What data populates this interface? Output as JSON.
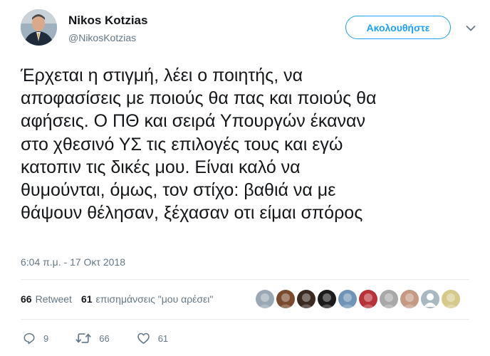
{
  "user": {
    "name": "Nikos Kotzias",
    "handle": "@NikosKotzias",
    "follow_label": "Ακολουθήστε"
  },
  "tweet": {
    "text": "Έρχεται η στιγμή, λέει ο ποιητής, να\nαποφασίσεις με ποιούς θα πας και ποιούς θα\nαφήσεις. Ο ΠΘ και σειρά Υπουργών έκαναν\nστο χθεσινό ΥΣ τις επιλογές τους και εγώ\nκατοπιν τις δικές μου.  Είναι καλό να\nθυμούνται, όμως, τον στίχο: βαθιά να με\nθάψουν θέλησαν, ξέχασαν οτι είμαι σπόρος",
    "timestamp": "6:04 π.μ. - 17 Οκτ 2018"
  },
  "stats": {
    "retweet_count": "66",
    "retweet_label": "Retweet",
    "like_count": "61",
    "like_label": "επισημάνσεις \"μου αρέσει\""
  },
  "likers": [
    {
      "icon": "liker-avatar",
      "color": "#9aa7b4"
    },
    {
      "icon": "liker-avatar",
      "color": "#7a4a2e"
    },
    {
      "icon": "liker-avatar",
      "color": "#3b2a22"
    },
    {
      "icon": "liker-avatar",
      "color": "#1b1b1b"
    },
    {
      "icon": "liker-avatar",
      "color": "#6f94b6"
    },
    {
      "icon": "liker-avatar",
      "color": "#b8323a"
    },
    {
      "icon": "liker-avatar",
      "color": "#a8a8a8"
    },
    {
      "icon": "liker-avatar",
      "color": "#c49a84"
    },
    {
      "icon": "liker-avatar-default",
      "color": "#aab8c2"
    },
    {
      "icon": "liker-avatar",
      "color": "#d6c98c"
    }
  ],
  "actions": {
    "reply_count": "9",
    "retweet_count": "66",
    "like_count": "61"
  },
  "colors": {
    "accent": "#1da1f2",
    "secondary_text": "#657786",
    "divider": "#e6ecf0"
  }
}
